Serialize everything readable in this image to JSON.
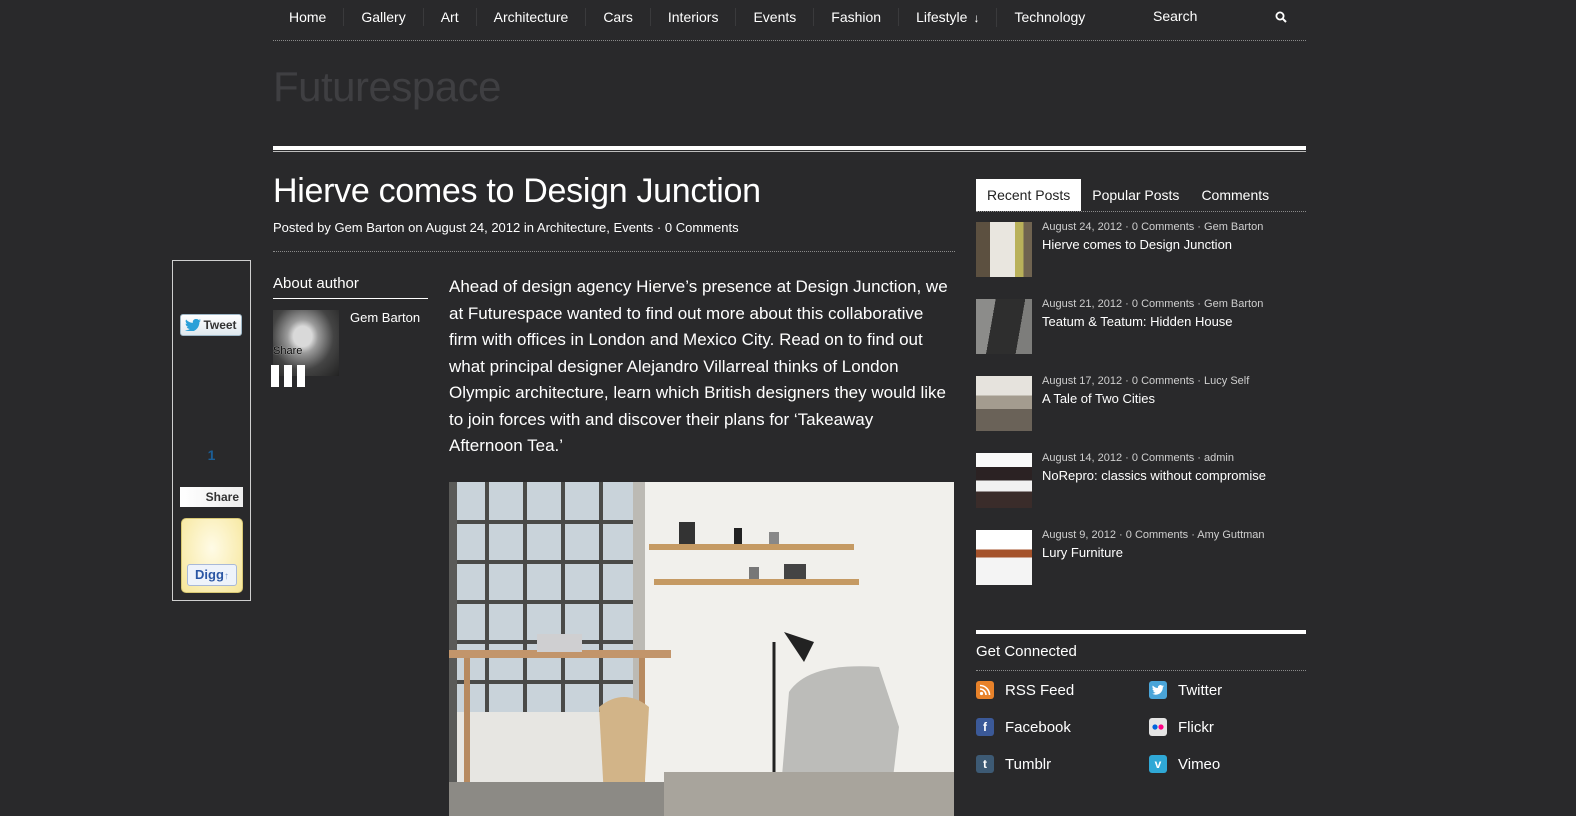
{
  "nav": {
    "items": [
      "Home",
      "Gallery",
      "Art",
      "Architecture",
      "Cars",
      "Interiors",
      "Events",
      "Fashion",
      "Lifestyle",
      "Technology"
    ],
    "search_placeholder": "Search"
  },
  "site": {
    "title": "Futurespace"
  },
  "post": {
    "title": "Hierve comes to Design Junction",
    "meta": {
      "posted_by": "Posted by",
      "author": "Gem Barton",
      "on": "on",
      "date": "August 24, 2012",
      "in": "in",
      "categories": [
        "Architecture",
        "Events"
      ],
      "comments": "0 Comments"
    },
    "intro": "Ahead of design agency Hierve’s presence at Design Junction, we at Futurespace wanted to find out more about this collaborative firm with offices in London and Mexico City. Read on to find out what principal designer Alejandro Villarreal thinks of London Olympic architecture, learn which British designers they would like to join forces with and discover their plans for ‘Takeaway Afternoon Tea.’"
  },
  "about": {
    "title": "About author",
    "author": "Gem Barton",
    "share_label": "Share"
  },
  "sharebox": {
    "tweet": "Tweet",
    "count": "1",
    "share": "Share",
    "digg": "Digg"
  },
  "sidebar": {
    "tabs": [
      "Recent Posts",
      "Popular Posts",
      "Comments"
    ],
    "recent": [
      {
        "meta": "August 24, 2012 · 0 Comments · Gem Barton",
        "title": "Hierve comes to Design Junction"
      },
      {
        "meta": "August 21, 2012 · 0 Comments · Gem Barton",
        "title": "Teatum & Teatum: Hidden House"
      },
      {
        "meta": "August 17, 2012 · 0 Comments · Lucy Self",
        "title": "A Tale of Two Cities"
      },
      {
        "meta": "August 14, 2012 · 0 Comments · admin",
        "title": "NoRepro: classics without compromise"
      },
      {
        "meta": "August 9, 2012 · 0 Comments · Amy Guttman",
        "title": "Lury Furniture"
      }
    ],
    "connect": {
      "title": "Get Connected",
      "items": [
        {
          "label": "RSS Feed",
          "icon": "rss-icon"
        },
        {
          "label": "Twitter",
          "icon": "twitter-icon"
        },
        {
          "label": "Facebook",
          "icon": "facebook-icon"
        },
        {
          "label": "Flickr",
          "icon": "flickr-icon"
        },
        {
          "label": "Tumblr",
          "icon": "tumblr-icon"
        },
        {
          "label": "Vimeo",
          "icon": "vimeo-icon"
        }
      ]
    }
  },
  "colors": {
    "background": "#29292b",
    "text": "#ffffff",
    "site_title": "#3f3f42",
    "share_count": "#1b5e96"
  }
}
